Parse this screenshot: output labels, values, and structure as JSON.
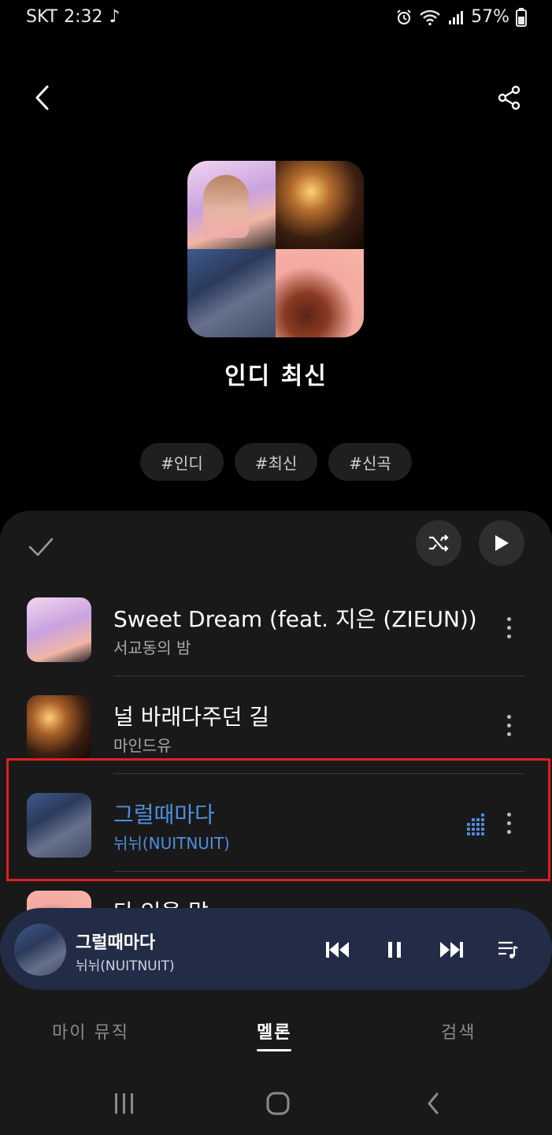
{
  "status_bar": {
    "carrier": "SKT",
    "time": "2:32",
    "music_note": "♪",
    "battery": "57%"
  },
  "playlist": {
    "title": "인디 최신",
    "tags": [
      "#인디",
      "#최신",
      "#신곡"
    ]
  },
  "tracks": [
    {
      "title": "Sweet Dream (feat. 지은 (ZIEUN))",
      "artist": "서교동의 밤"
    },
    {
      "title": "널 바래다주던 길",
      "artist": "마인드유"
    },
    {
      "title": "그럴때마다",
      "artist": "뉘뉘(NUITNUIT)"
    },
    {
      "title": "다 있을 말",
      "artist": ""
    }
  ],
  "now_playing": {
    "title": "그럴때마다",
    "artist": "뉘뉘(NUITNUIT)"
  },
  "bottom_tabs": {
    "my_music": "마이 뮤직",
    "melon": "멜론",
    "search": "검색"
  },
  "colors": {
    "accent": "#4f8fe0",
    "panel": "#191919",
    "mini_player": "#222c47",
    "highlight": "#e02020"
  }
}
